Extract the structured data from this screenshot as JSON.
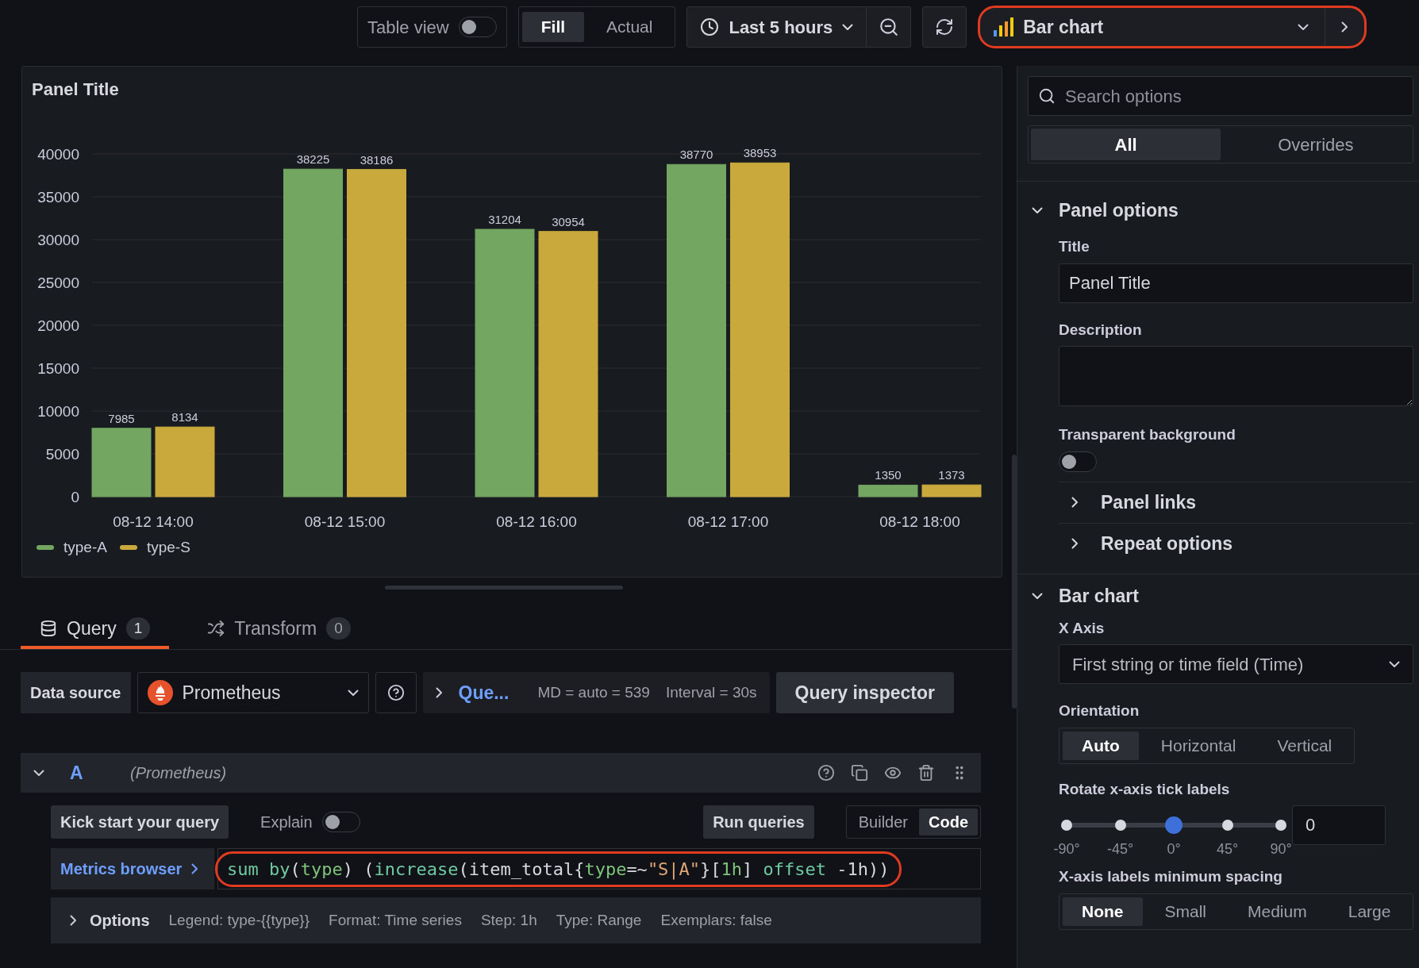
{
  "top_bar": {
    "table_view": {
      "label": "Table view",
      "on": false
    },
    "fill_modes": [
      {
        "label": "Fill",
        "selected": true
      },
      {
        "label": "Actual",
        "selected": false
      }
    ],
    "time_range": "Last 5 hours",
    "visualization": {
      "label": "Bar chart",
      "highlighted": true
    }
  },
  "panel": {
    "title": "Panel Title",
    "chart_data": {
      "type": "bar",
      "categories": [
        "08-12 14:00",
        "08-12 15:00",
        "08-12 16:00",
        "08-12 17:00",
        "08-12 18:00"
      ],
      "series": [
        {
          "name": "type-A",
          "color": "#73a661",
          "values": [
            7985,
            38225,
            31204,
            38770,
            1350
          ]
        },
        {
          "name": "type-S",
          "color": "#c9a93c",
          "values": [
            8134,
            38186,
            30954,
            38953,
            1373
          ]
        }
      ],
      "ylim": [
        0,
        40000
      ],
      "yticks": [
        0,
        5000,
        10000,
        15000,
        20000,
        25000,
        30000,
        35000,
        40000
      ],
      "grid": true,
      "data_labels": true
    }
  },
  "query_tabs": [
    {
      "label": "Query",
      "count": "1",
      "selected": true
    },
    {
      "label": "Transform",
      "count": "0",
      "selected": false
    }
  ],
  "query_bar": {
    "data_source_label": "Data source",
    "data_source": "Prometheus",
    "query_options": "Que...",
    "max_data_points": "MD = auto = 539",
    "interval": "Interval = 30s",
    "inspector": "Query inspector"
  },
  "query": {
    "letter": "A",
    "data_source": "(Prometheus)",
    "expanded": true,
    "kick_start": "Kick start your query",
    "explain": {
      "label": "Explain",
      "on": false
    },
    "run": "Run queries",
    "modes": [
      {
        "label": "Builder",
        "selected": false
      },
      {
        "label": "Code",
        "selected": true
      }
    ],
    "metrics_browser": "Metrics browser",
    "expression": {
      "highlighted": true,
      "tokens": [
        {
          "text": "sum by",
          "kind": "keyword"
        },
        {
          "text": "(",
          "kind": "plain"
        },
        {
          "text": "type",
          "kind": "label"
        },
        {
          "text": ") (",
          "kind": "plain"
        },
        {
          "text": "increase",
          "kind": "function"
        },
        {
          "text": "(item_total{",
          "kind": "plain"
        },
        {
          "text": "type",
          "kind": "label"
        },
        {
          "text": "=~",
          "kind": "plain"
        },
        {
          "text": "\"S|A\"",
          "kind": "string"
        },
        {
          "text": "}[",
          "kind": "plain"
        },
        {
          "text": "1h",
          "kind": "number"
        },
        {
          "text": "] ",
          "kind": "plain"
        },
        {
          "text": "offset",
          "kind": "keyword"
        },
        {
          "text": " -1h))",
          "kind": "plain"
        }
      ]
    },
    "options_label": "Options",
    "options": [
      "Legend: type-{{type}}",
      "Format: Time series",
      "Step: 1h",
      "Type: Range",
      "Exemplars: false"
    ]
  },
  "options_pane": {
    "search_placeholder": "Search options",
    "tabs": [
      {
        "label": "All",
        "selected": true
      },
      {
        "label": "Overrides",
        "selected": false
      }
    ],
    "panel_options": {
      "title": "Panel options",
      "expanded": true,
      "title_label": "Title",
      "title_value": "Panel Title",
      "description_label": "Description",
      "transparent_label": "Transparent background",
      "transparent_on": false,
      "subsections": [
        {
          "label": "Panel links",
          "expanded": false
        },
        {
          "label": "Repeat options",
          "expanded": false
        }
      ]
    },
    "bar_chart": {
      "title": "Bar chart",
      "expanded": true,
      "x_axis_label": "X Axis",
      "x_axis_value": "First string or time field (Time)",
      "orientation_label": "Orientation",
      "orientations": [
        {
          "label": "Auto",
          "selected": true
        },
        {
          "label": "Horizontal",
          "selected": false
        },
        {
          "label": "Vertical",
          "selected": false
        }
      ],
      "rotate_label": "Rotate x-axis tick labels",
      "rotate_slider": {
        "level": 0.5,
        "ticks": [
          "-90°",
          "-45°",
          "0°",
          "45°",
          "90°"
        ]
      },
      "rotate_value": "0",
      "spacing_label": "X-axis labels minimum spacing",
      "spacings": [
        {
          "label": "None",
          "selected": true
        },
        {
          "label": "Small",
          "selected": false
        },
        {
          "label": "Medium",
          "selected": false
        },
        {
          "label": "Large",
          "selected": false
        }
      ]
    }
  }
}
